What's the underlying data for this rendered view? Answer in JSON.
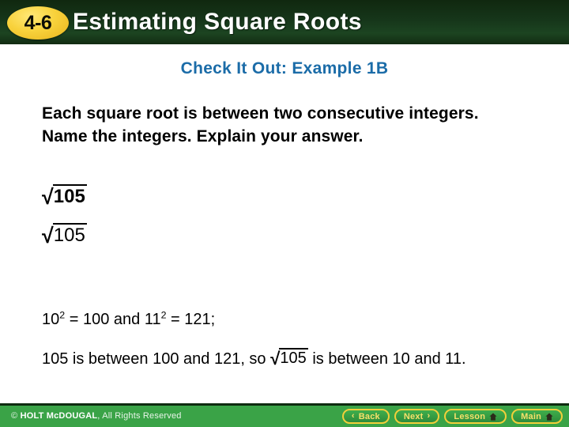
{
  "header": {
    "lesson_number": "4-6",
    "title": "Estimating Square Roots",
    "badge_color": "#f8d23c",
    "background_color": "#16361a"
  },
  "main": {
    "example_title": "Check It Out: Example 1B",
    "example_title_color": "#1b6ca8",
    "prompt": "Each square root is between two consecutive integers. Name the integers. Explain your answer.",
    "problem": {
      "radical_symbol": "√",
      "radicand": "105",
      "bold": true
    },
    "answer_restatement": {
      "radical_symbol": "√",
      "radicand": "105",
      "bold": false
    },
    "equation": {
      "base_one": "10",
      "exponent_one": "2",
      "equals": " = ",
      "value_one": "100",
      "conjunction": " and ",
      "base_two": "11",
      "exponent_two": "2",
      "value_two": "121;",
      "full_text": "102 = 100 and 112 = 121;"
    },
    "conclusion": {
      "part_one": "105 is between 100 and 121, so ",
      "radical_symbol": "√",
      "radicand": "105",
      "part_two": " is between 10 and 11.",
      "full_text": "105 is between 100 and 121, so √105 is between 10 and 11."
    }
  },
  "footer": {
    "copyright_symbol": "© ",
    "brand": "HOLT McDOUGAL",
    "rights": ", All Rights Reserved",
    "background_color": "#3aa347",
    "buttons": [
      {
        "label": "Back",
        "icon": "chevron-left-icon",
        "glyph": "‹"
      },
      {
        "label": "Next",
        "icon": "chevron-right-icon",
        "glyph": "›"
      },
      {
        "label": "Lesson",
        "icon": "home-icon",
        "glyph": ""
      },
      {
        "label": "Main",
        "icon": "home-icon",
        "glyph": ""
      }
    ]
  }
}
